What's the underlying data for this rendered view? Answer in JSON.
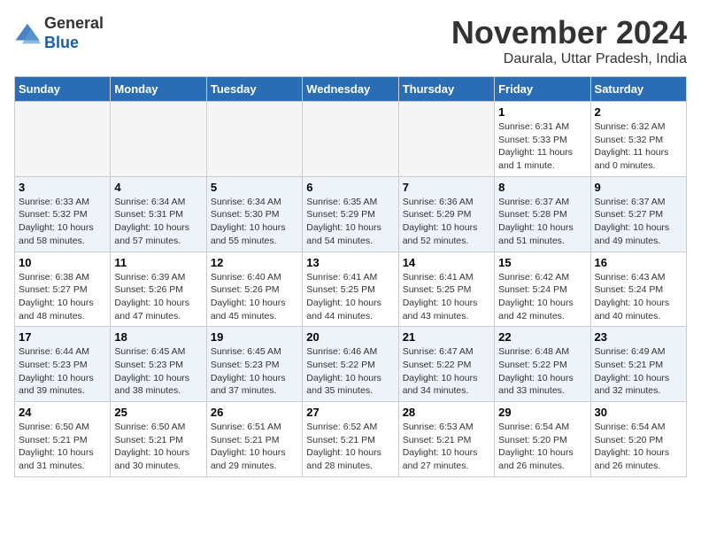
{
  "header": {
    "logo_line1": "General",
    "logo_line2": "Blue",
    "month_title": "November 2024",
    "subtitle": "Daurala, Uttar Pradesh, India"
  },
  "days_of_week": [
    "Sunday",
    "Monday",
    "Tuesday",
    "Wednesday",
    "Thursday",
    "Friday",
    "Saturday"
  ],
  "weeks": [
    [
      {
        "day": "",
        "info": ""
      },
      {
        "day": "",
        "info": ""
      },
      {
        "day": "",
        "info": ""
      },
      {
        "day": "",
        "info": ""
      },
      {
        "day": "",
        "info": ""
      },
      {
        "day": "1",
        "info": "Sunrise: 6:31 AM\nSunset: 5:33 PM\nDaylight: 11 hours and 1 minute."
      },
      {
        "day": "2",
        "info": "Sunrise: 6:32 AM\nSunset: 5:32 PM\nDaylight: 11 hours and 0 minutes."
      }
    ],
    [
      {
        "day": "3",
        "info": "Sunrise: 6:33 AM\nSunset: 5:32 PM\nDaylight: 10 hours and 58 minutes."
      },
      {
        "day": "4",
        "info": "Sunrise: 6:34 AM\nSunset: 5:31 PM\nDaylight: 10 hours and 57 minutes."
      },
      {
        "day": "5",
        "info": "Sunrise: 6:34 AM\nSunset: 5:30 PM\nDaylight: 10 hours and 55 minutes."
      },
      {
        "day": "6",
        "info": "Sunrise: 6:35 AM\nSunset: 5:29 PM\nDaylight: 10 hours and 54 minutes."
      },
      {
        "day": "7",
        "info": "Sunrise: 6:36 AM\nSunset: 5:29 PM\nDaylight: 10 hours and 52 minutes."
      },
      {
        "day": "8",
        "info": "Sunrise: 6:37 AM\nSunset: 5:28 PM\nDaylight: 10 hours and 51 minutes."
      },
      {
        "day": "9",
        "info": "Sunrise: 6:37 AM\nSunset: 5:27 PM\nDaylight: 10 hours and 49 minutes."
      }
    ],
    [
      {
        "day": "10",
        "info": "Sunrise: 6:38 AM\nSunset: 5:27 PM\nDaylight: 10 hours and 48 minutes."
      },
      {
        "day": "11",
        "info": "Sunrise: 6:39 AM\nSunset: 5:26 PM\nDaylight: 10 hours and 47 minutes."
      },
      {
        "day": "12",
        "info": "Sunrise: 6:40 AM\nSunset: 5:26 PM\nDaylight: 10 hours and 45 minutes."
      },
      {
        "day": "13",
        "info": "Sunrise: 6:41 AM\nSunset: 5:25 PM\nDaylight: 10 hours and 44 minutes."
      },
      {
        "day": "14",
        "info": "Sunrise: 6:41 AM\nSunset: 5:25 PM\nDaylight: 10 hours and 43 minutes."
      },
      {
        "day": "15",
        "info": "Sunrise: 6:42 AM\nSunset: 5:24 PM\nDaylight: 10 hours and 42 minutes."
      },
      {
        "day": "16",
        "info": "Sunrise: 6:43 AM\nSunset: 5:24 PM\nDaylight: 10 hours and 40 minutes."
      }
    ],
    [
      {
        "day": "17",
        "info": "Sunrise: 6:44 AM\nSunset: 5:23 PM\nDaylight: 10 hours and 39 minutes."
      },
      {
        "day": "18",
        "info": "Sunrise: 6:45 AM\nSunset: 5:23 PM\nDaylight: 10 hours and 38 minutes."
      },
      {
        "day": "19",
        "info": "Sunrise: 6:45 AM\nSunset: 5:23 PM\nDaylight: 10 hours and 37 minutes."
      },
      {
        "day": "20",
        "info": "Sunrise: 6:46 AM\nSunset: 5:22 PM\nDaylight: 10 hours and 35 minutes."
      },
      {
        "day": "21",
        "info": "Sunrise: 6:47 AM\nSunset: 5:22 PM\nDaylight: 10 hours and 34 minutes."
      },
      {
        "day": "22",
        "info": "Sunrise: 6:48 AM\nSunset: 5:22 PM\nDaylight: 10 hours and 33 minutes."
      },
      {
        "day": "23",
        "info": "Sunrise: 6:49 AM\nSunset: 5:21 PM\nDaylight: 10 hours and 32 minutes."
      }
    ],
    [
      {
        "day": "24",
        "info": "Sunrise: 6:50 AM\nSunset: 5:21 PM\nDaylight: 10 hours and 31 minutes."
      },
      {
        "day": "25",
        "info": "Sunrise: 6:50 AM\nSunset: 5:21 PM\nDaylight: 10 hours and 30 minutes."
      },
      {
        "day": "26",
        "info": "Sunrise: 6:51 AM\nSunset: 5:21 PM\nDaylight: 10 hours and 29 minutes."
      },
      {
        "day": "27",
        "info": "Sunrise: 6:52 AM\nSunset: 5:21 PM\nDaylight: 10 hours and 28 minutes."
      },
      {
        "day": "28",
        "info": "Sunrise: 6:53 AM\nSunset: 5:21 PM\nDaylight: 10 hours and 27 minutes."
      },
      {
        "day": "29",
        "info": "Sunrise: 6:54 AM\nSunset: 5:20 PM\nDaylight: 10 hours and 26 minutes."
      },
      {
        "day": "30",
        "info": "Sunrise: 6:54 AM\nSunset: 5:20 PM\nDaylight: 10 hours and 26 minutes."
      }
    ]
  ]
}
